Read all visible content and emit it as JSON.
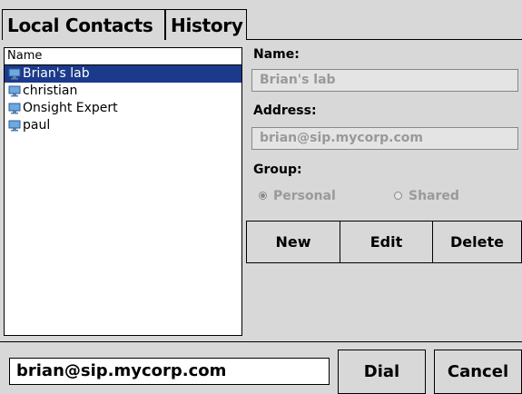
{
  "tabs": {
    "local_contacts": "Local Contacts",
    "history": "History"
  },
  "contact_list": {
    "header": "Name",
    "items": [
      {
        "name": "Brian's lab",
        "selected": true
      },
      {
        "name": "christian",
        "selected": false
      },
      {
        "name": "Onsight Expert",
        "selected": false
      },
      {
        "name": "paul",
        "selected": false
      }
    ]
  },
  "details": {
    "name_label": "Name:",
    "name_value": "Brian's lab",
    "address_label": "Address:",
    "address_value": "brian@sip.mycorp.com",
    "group_label": "Group:",
    "group_options": [
      {
        "label": "Personal",
        "checked": true
      },
      {
        "label": "Shared",
        "checked": false
      }
    ]
  },
  "actions": {
    "new": "New",
    "edit": "Edit",
    "delete": "Delete"
  },
  "dial_bar": {
    "input_value": "brian@sip.mycorp.com",
    "dial": "Dial",
    "cancel": "Cancel"
  },
  "colors": {
    "selection": "#1c3a8c",
    "background": "#d8d8d8"
  },
  "icons": {
    "contact": "computer-monitor-icon"
  }
}
